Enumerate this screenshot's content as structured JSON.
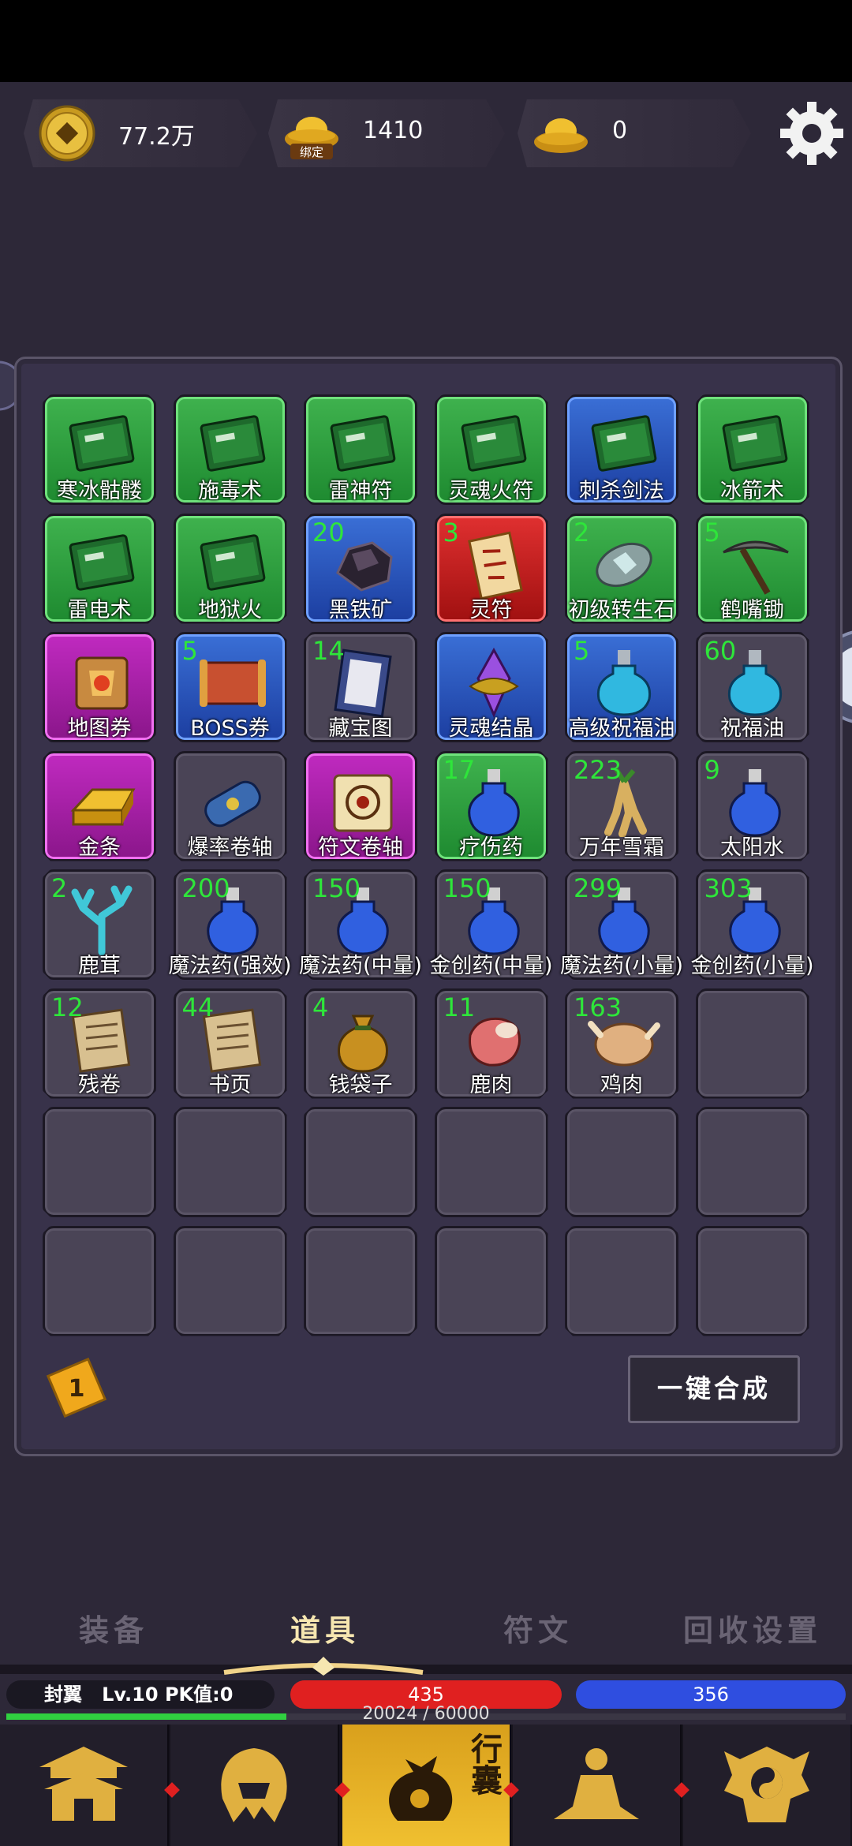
{
  "currency": {
    "copper": {
      "value": "77.2万",
      "icon": "copper-coin-icon"
    },
    "bound_gold": {
      "value": "1410",
      "icon": "bound-gold-ingot-icon",
      "badge": "绑定"
    },
    "gold": {
      "value": "0",
      "icon": "gold-ingot-icon"
    }
  },
  "inventory": {
    "items": [
      {
        "name": "寒冰骷髅",
        "count": "",
        "rarity": "green",
        "icon": "skill-book-icon"
      },
      {
        "name": "施毒术",
        "count": "",
        "rarity": "green",
        "icon": "skill-book-icon"
      },
      {
        "name": "雷神符",
        "count": "",
        "rarity": "green",
        "icon": "skill-book-icon"
      },
      {
        "name": "灵魂火符",
        "count": "",
        "rarity": "green",
        "icon": "skill-book-icon"
      },
      {
        "name": "刺杀剑法",
        "count": "",
        "rarity": "blue",
        "icon": "skill-book-icon"
      },
      {
        "name": "冰箭术",
        "count": "",
        "rarity": "green",
        "icon": "skill-book-icon"
      },
      {
        "name": "雷电术",
        "count": "",
        "rarity": "green",
        "icon": "skill-book-icon"
      },
      {
        "name": "地狱火",
        "count": "",
        "rarity": "green",
        "icon": "skill-book-icon"
      },
      {
        "name": "黑铁矿",
        "count": "20",
        "rarity": "blue",
        "icon": "ore-icon"
      },
      {
        "name": "灵符",
        "count": "3",
        "rarity": "red",
        "icon": "talisman-icon"
      },
      {
        "name": "初级转生石",
        "count": "2",
        "rarity": "green",
        "icon": "rebirth-stone-icon"
      },
      {
        "name": "鹤嘴锄",
        "count": "5",
        "rarity": "green",
        "icon": "pickaxe-icon"
      },
      {
        "name": "地图券",
        "count": "",
        "rarity": "purple",
        "icon": "map-scroll-icon"
      },
      {
        "name": "BOSS券",
        "count": "5",
        "rarity": "blue",
        "icon": "boss-scroll-icon"
      },
      {
        "name": "藏宝图",
        "count": "14",
        "rarity": "gray",
        "icon": "treasure-map-icon"
      },
      {
        "name": "灵魂结晶",
        "count": "",
        "rarity": "blue",
        "icon": "crystal-icon"
      },
      {
        "name": "高级祝福油",
        "count": "5",
        "rarity": "blue",
        "icon": "blessing-oil-icon"
      },
      {
        "name": "祝福油",
        "count": "60",
        "rarity": "gray",
        "icon": "blessing-oil-icon"
      },
      {
        "name": "金条",
        "count": "",
        "rarity": "purple",
        "icon": "gold-bar-icon"
      },
      {
        "name": "爆率卷轴",
        "count": "",
        "rarity": "gray",
        "icon": "scroll-icon"
      },
      {
        "name": "符文卷轴",
        "count": "",
        "rarity": "purple",
        "icon": "rune-scroll-icon"
      },
      {
        "name": "疗伤药",
        "count": "17",
        "rarity": "green",
        "icon": "potion-icon"
      },
      {
        "name": "万年雪霜",
        "count": "223",
        "rarity": "gray",
        "icon": "ginseng-icon"
      },
      {
        "name": "太阳水",
        "count": "9",
        "rarity": "gray",
        "icon": "potion-icon"
      },
      {
        "name": "鹿茸",
        "count": "2",
        "rarity": "gray",
        "icon": "antler-icon"
      },
      {
        "name": "魔法药(强效)",
        "count": "200",
        "rarity": "gray",
        "icon": "potion-icon"
      },
      {
        "name": "魔法药(中量)",
        "count": "150",
        "rarity": "gray",
        "icon": "potion-icon"
      },
      {
        "name": "金创药(中量)",
        "count": "150",
        "rarity": "gray",
        "icon": "potion-icon"
      },
      {
        "name": "魔法药(小量)",
        "count": "299",
        "rarity": "gray",
        "icon": "potion-icon"
      },
      {
        "name": "金创药(小量)",
        "count": "303",
        "rarity": "gray",
        "icon": "potion-icon"
      },
      {
        "name": "残卷",
        "count": "12",
        "rarity": "gray",
        "icon": "paper-icon"
      },
      {
        "name": "书页",
        "count": "44",
        "rarity": "gray",
        "icon": "paper-icon"
      },
      {
        "name": "钱袋子",
        "count": "4",
        "rarity": "gray",
        "icon": "money-bag-icon"
      },
      {
        "name": "鹿肉",
        "count": "11",
        "rarity": "gray",
        "icon": "meat-icon"
      },
      {
        "name": "鸡肉",
        "count": "163",
        "rarity": "gray",
        "icon": "chicken-icon"
      }
    ],
    "page": "1",
    "merge_button": "一键合成"
  },
  "tabs": [
    {
      "label": "装备",
      "active": false
    },
    {
      "label": "道具",
      "active": true
    },
    {
      "label": "符文",
      "active": false
    },
    {
      "label": "回收设置",
      "active": false
    }
  ],
  "player": {
    "name": "封翼",
    "level": "Lv.10",
    "pk": "PK值:0",
    "hp": "435",
    "mp": "356",
    "exp_text": "20024 / 60000",
    "exp_fraction": 0.3337
  },
  "bottom_nav": [
    {
      "icon": "town-icon",
      "active": false
    },
    {
      "icon": "helmet-icon",
      "active": false
    },
    {
      "icon": "bag-icon",
      "label": "行囊",
      "active": true
    },
    {
      "icon": "meditation-icon",
      "active": false
    },
    {
      "icon": "taiji-icon",
      "active": false
    }
  ],
  "colors": {
    "green": "#2f9e3e",
    "blue": "#2a55c0",
    "red": "#c82020",
    "purple": "#a820a8",
    "gray": "#4a4456",
    "count": "#2ee63a",
    "active_tab": "#f6e6b0"
  }
}
